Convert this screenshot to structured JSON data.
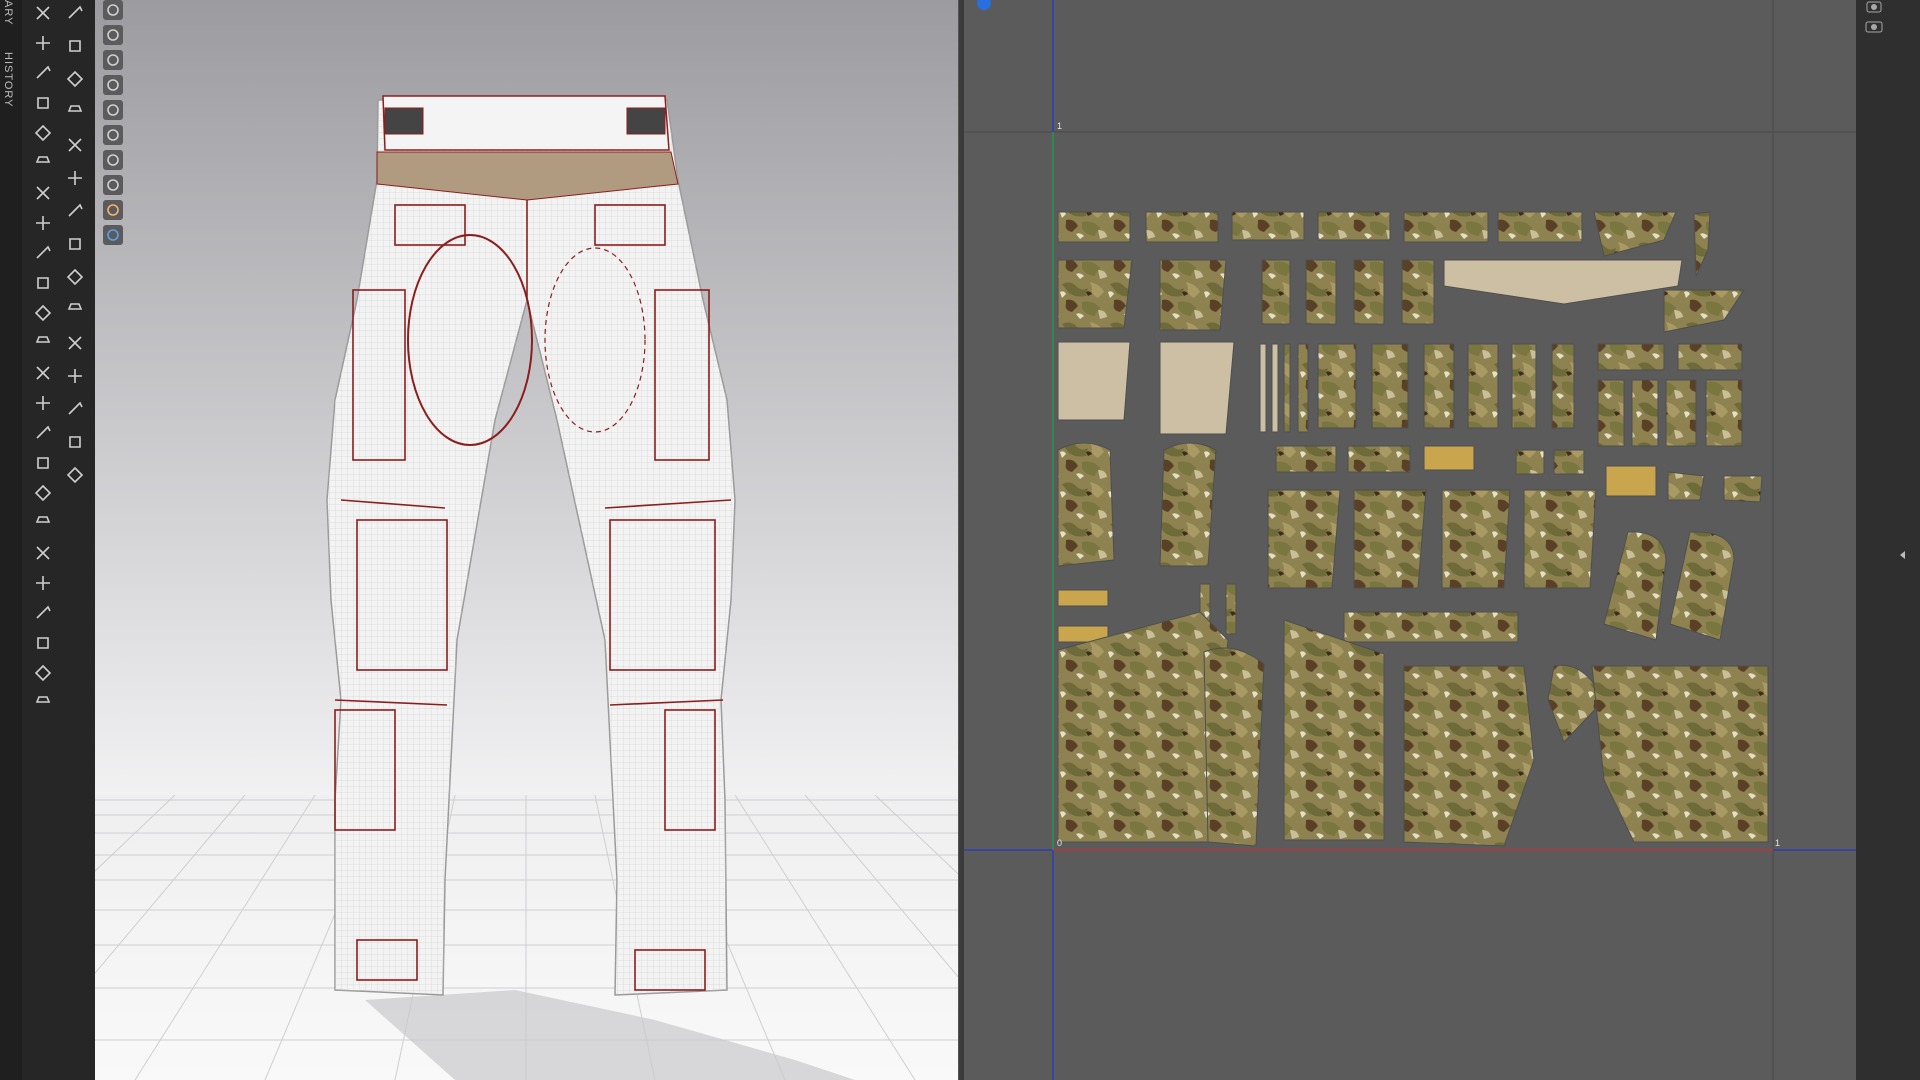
{
  "side_tabs": {
    "library_label": "ARY",
    "history_label": "HISTORY"
  },
  "toolbar": {
    "col1_icons": [
      "select-pattern-icon",
      "transform-pattern-icon",
      "edit-point-icon",
      "edit-curvature-icon",
      "add-point-icon",
      "garment-icon",
      "garment-fit-icon",
      "garment-size-icon",
      "tuck-icon",
      "fold-icon",
      "segment-icon",
      "internal-line-icon",
      "internal-shape-icon",
      "trace-icon",
      "polygon-icon",
      "rectangle-icon",
      "circle-icon",
      "sewing-icon",
      "free-sewing-icon",
      "seam-icon",
      "topstitch-icon",
      "arrangement-icon",
      "symmetry-icon",
      "avatar-icon"
    ],
    "col2_icons": [
      "select-mesh-icon",
      "move-mesh-icon",
      "pin-icon",
      "fabric-icon",
      "texture-icon",
      "trim-icon",
      "button-icon",
      "buttonhole-icon",
      "zipper-icon",
      "measure-icon",
      "tape-icon",
      "puckering-icon",
      "fold-arrangement-icon",
      "grading-icon",
      "sew-line-icon"
    ]
  },
  "viewport3d": {
    "tools": [
      "wireframe-icon",
      "avatar-display-icon",
      "fabric-display-icon",
      "texture-display-icon",
      "stress-map-icon",
      "strain-map-icon",
      "shading-icon",
      "light-icon",
      "avatar-skin-icon",
      "environment-icon"
    ],
    "colors": {
      "bg_top": "#9c9ca0",
      "bg_bottom": "#f7f7f7",
      "seam": "#8b1e1e",
      "fabric": "#f2f2f2",
      "waistband": "#b09a80"
    }
  },
  "viewport2d": {
    "grid_labels": {
      "top_left": "1",
      "bottom_left": "0",
      "bottom_right": "1"
    },
    "colors": {
      "bg": "#5b5b5b",
      "axis_x": "#c0392b",
      "axis_y": "#2a9d3a",
      "boundary": "#2b3fb8",
      "camo_base": "#8d8250"
    }
  },
  "right_panel": {
    "icons": [
      "snapshot-icon",
      "camera-icon",
      "collapse-arrow-icon"
    ]
  }
}
